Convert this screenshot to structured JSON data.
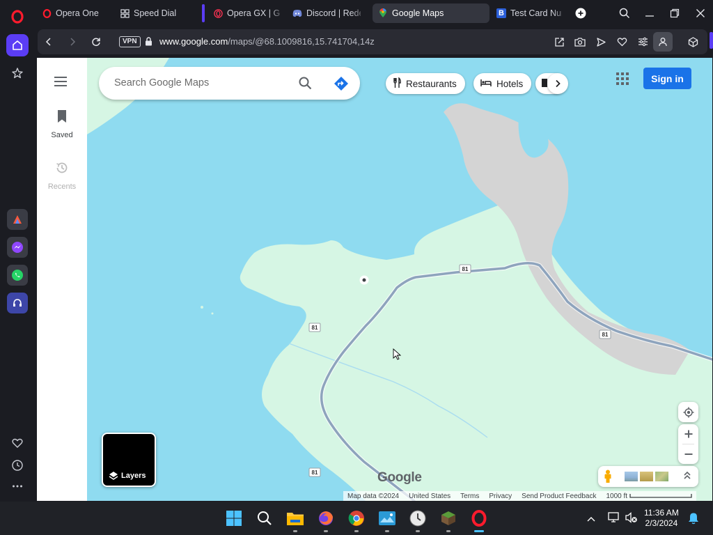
{
  "browser": {
    "tabs": [
      {
        "label": "Opera One",
        "icon": "opera-icon"
      },
      {
        "label": "Speed Dial",
        "icon": "speed-dial-icon"
      },
      {
        "label": "Opera GX | Gam",
        "icon": "opera-gx-icon"
      },
      {
        "label": "Discord | Redee",
        "icon": "discord-icon"
      },
      {
        "label": "Google Maps",
        "icon": "maps-pin-icon",
        "active": true
      },
      {
        "label": "Test Card Numb",
        "icon": "b-icon"
      }
    ],
    "address": {
      "vpn_label": "VPN",
      "url_host": "www.google.com",
      "url_path": "/maps/@68.1009816,15.741704,14z"
    }
  },
  "maps": {
    "search_placeholder": "Search Google Maps",
    "sidebar": {
      "saved_label": "Saved",
      "recents_label": "Recents"
    },
    "chips": [
      "Restaurants",
      "Hotels"
    ],
    "signin_label": "Sign in",
    "layers_label": "Layers",
    "road_number": "81",
    "logo": "Google",
    "attribution": {
      "map_data": "Map data ©2024",
      "region": "United States",
      "terms": "Terms",
      "privacy": "Privacy",
      "feedback": "Send Product Feedback",
      "scale": "1000 ft"
    },
    "colors": {
      "water": "#8fdbf0",
      "land": "#d6f6e4",
      "urban": "#d4d4d4",
      "road": "#8ea4bd",
      "accent": "#1a73e8"
    }
  },
  "taskbar": {
    "time": "11:36 AM",
    "date": "2/3/2024"
  }
}
